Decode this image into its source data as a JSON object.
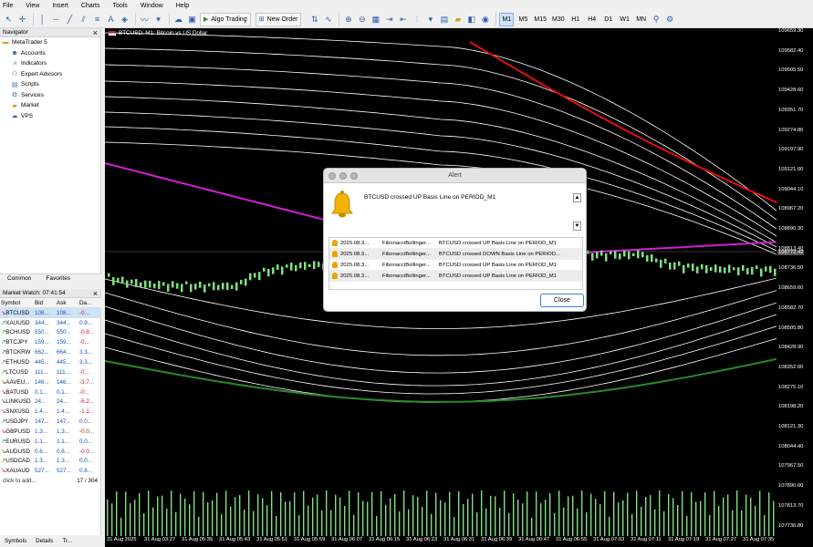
{
  "menu": [
    "File",
    "View",
    "Insert",
    "Charts",
    "Tools",
    "Window",
    "Help"
  ],
  "toolbar": {
    "algo_trading": "Algo Trading",
    "new_order": "New Order",
    "timeframes": [
      "M1",
      "M5",
      "M15",
      "M30",
      "H1",
      "H4",
      "D1",
      "W1",
      "MN"
    ],
    "active_timeframe": "M1"
  },
  "navigator": {
    "title": "Navigator",
    "items": [
      {
        "label": "MetaTrader 5",
        "icon": "folder-icon"
      },
      {
        "label": "Accounts",
        "icon": "accounts-icon"
      },
      {
        "label": "Indicators",
        "icon": "indicators-icon"
      },
      {
        "label": "Expert Advisors",
        "icon": "expert-icon"
      },
      {
        "label": "Scripts",
        "icon": "scripts-icon"
      },
      {
        "label": "Services",
        "icon": "services-icon"
      },
      {
        "label": "Market",
        "icon": "market-icon"
      },
      {
        "label": "VPS",
        "icon": "vps-icon"
      }
    ],
    "tabs": [
      "Common",
      "Favorites"
    ]
  },
  "market_watch": {
    "title": "Market Watch: 07:41:54",
    "columns": [
      "Symbol",
      "Bid",
      "Ask",
      "Da..."
    ],
    "rows": [
      {
        "symbol": "BTCUSD",
        "bid": "108...",
        "ask": "108...",
        "daily": "-0...",
        "dir": "down"
      },
      {
        "symbol": "XAUUSD",
        "bid": "344...",
        "ask": "344...",
        "daily": "0.9...",
        "dir": "up"
      },
      {
        "symbol": "BCHUSD",
        "bid": "550...",
        "ask": "550...",
        "daily": "-0.8...",
        "dir": "up"
      },
      {
        "symbol": "BTCJPY",
        "bid": "159...",
        "ask": "159...",
        "daily": "-0...",
        "dir": "up"
      },
      {
        "symbol": "BTCKRW",
        "bid": "662...",
        "ask": "664...",
        "daily": "3.3...",
        "dir": "up"
      },
      {
        "symbol": "ETHUSD",
        "bid": "445...",
        "ask": "445...",
        "daily": "3.3...",
        "dir": "up"
      },
      {
        "symbol": "LTCUSD",
        "bid": "111...",
        "ask": "111...",
        "daily": "-0...",
        "dir": "up"
      },
      {
        "symbol": "AAVEU...",
        "bid": "146...",
        "ask": "146...",
        "daily": "-3.7...",
        "dir": "down"
      },
      {
        "symbol": "BATUSD",
        "bid": "0.1...",
        "ask": "0.1...",
        "daily": "-0...",
        "dir": "down"
      },
      {
        "symbol": "LINKUSD",
        "bid": "24...",
        "ask": "24...",
        "daily": "-6.2...",
        "dir": "down"
      },
      {
        "symbol": "SNXUSD",
        "bid": "1.4...",
        "ask": "1.4...",
        "daily": "-1.1...",
        "dir": "down"
      },
      {
        "symbol": "USDJPY",
        "bid": "147...",
        "ask": "147...",
        "daily": "0.0...",
        "dir": "up"
      },
      {
        "symbol": "GBPUSD",
        "bid": "1.3...",
        "ask": "1.3...",
        "daily": "-0.0...",
        "dir": "down"
      },
      {
        "symbol": "EURUSD",
        "bid": "1.1...",
        "ask": "1.1...",
        "daily": "0.0...",
        "dir": "up"
      },
      {
        "symbol": "AUDUSD",
        "bid": "0.6...",
        "ask": "0.6...",
        "daily": "-0.0...",
        "dir": "down"
      },
      {
        "symbol": "USDCAD",
        "bid": "1.3...",
        "ask": "1.3...",
        "daily": "0.0...",
        "dir": "up"
      },
      {
        "symbol": "XAUAUD",
        "bid": "527...",
        "ask": "527...",
        "daily": "0.8...",
        "dir": "down"
      }
    ],
    "add_text": "click to add...",
    "count": "17 / 304",
    "tabs": [
      "Symbols",
      "Details",
      "Tr..."
    ]
  },
  "chart": {
    "title": "BTCUSD, M1: Bitcoin vs US Dollar",
    "price_labels": [
      "109659.30",
      "109582.40",
      "109505.50",
      "109428.60",
      "109351.70",
      "109274.80",
      "109197.90",
      "109121.00",
      "109044.10",
      "108967.20",
      "108890.30",
      "108813.40",
      "108736.50",
      "108659.60",
      "108582.70",
      "108505.80",
      "108428.90",
      "108352.00",
      "108275.10",
      "108198.20",
      "108121.30",
      "108044.40",
      "107967.50",
      "107890.60",
      "107813.70",
      "107736.80"
    ],
    "current_price": "108772.42",
    "time_labels": [
      "31 Aug 2025",
      "31 Aug 03:27",
      "31 Aug 05:35",
      "31 Aug 05:43",
      "31 Aug 05:51",
      "31 Aug 05:59",
      "31 Aug 06:07",
      "31 Aug 06:15",
      "31 Aug 06:23",
      "31 Aug 06:31",
      "31 Aug 06:39",
      "31 Aug 06:47",
      "31 Aug 06:55",
      "31 Aug 07:03",
      "31 Aug 07:11",
      "31 Aug 07:19",
      "31 Aug 07:27",
      "31 Aug 07:35"
    ]
  },
  "alert": {
    "title": "Alert",
    "message": "BTCUSD crossed UP Basis Line on PERIOD_M1",
    "rows": [
      {
        "time": "2025.08.3...",
        "indicator": "FibonacciBollinger...",
        "text": "BTCUSD crossed UP Basis Line on PERIOD_M1"
      },
      {
        "time": "2025.08.3...",
        "indicator": "FibonacciBollinger...",
        "text": "BTCUSD crossed DOWN Basis Line on PERIOD..."
      },
      {
        "time": "2025.08.3...",
        "indicator": "FibonacciBollinger...",
        "text": "BTCUSD crossed UP Basis Line on PERIOD_M1"
      },
      {
        "time": "2025.08.3...",
        "indicator": "FibonacciBollinger...",
        "text": "BTCUSD crossed UP Basis Line on PERIOD_M1"
      }
    ],
    "close_label": "Close"
  },
  "colors": {
    "chart_bg": "#000000",
    "candles": "#7fe07f",
    "upper_band": "#e01010",
    "basis": "#d020d0",
    "lower_band": "#2a8a2a",
    "bands": "#ffffff"
  }
}
